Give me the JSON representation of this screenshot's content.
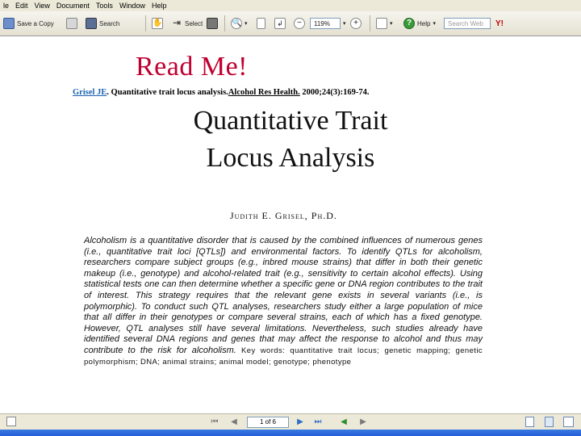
{
  "menu": {
    "items": [
      "le",
      "Edit",
      "View",
      "Document",
      "Tools",
      "Window",
      "Help"
    ]
  },
  "toolbar": {
    "save_copy": "Save a Copy",
    "search": "Search",
    "select": "Select",
    "zoom_value": "119%",
    "help": "Help",
    "search_web_placeholder": "Search Web",
    "yahoo": "Y!"
  },
  "document": {
    "heading": "Read Me!",
    "citation": {
      "author_link": "Grisel JE",
      "after_author": ". Quantitative trait locus analysis.",
      "journal": "Alcohol Res Health.",
      "rest": " 2000;24(3):169-74."
    },
    "title_line1": "Quantitative Trait",
    "title_line2": "Locus Analysis",
    "author": "Judith E. Grisel, Ph.D.",
    "abstract": "Alcoholism is a quantitative disorder that is caused by the combined influences of numerous genes (i.e., quantitative trait loci [QTLs]) and environmental factors. To identify QTLs for alcoholism, researchers compare subject groups (e.g., inbred mouse strains) that differ in both their genetic makeup (i.e., genotype) and alcohol-related trait (e.g., sensitivity to certain alcohol effects). Using statistical tests one can then determine whether a specific gene or DNA region contributes to the trait of interest. This strategy requires that the relevant gene exists in several variants (i.e., is polymorphic). To conduct such QTL analyses, researchers study either a large population of mice that all differ in their genotypes or compare several strains, each of which has a fixed genotype. However, QTL analyses still have several limitations. Nevertheless, such studies already have identified several DNA regions and genes that may affect the response to alcohol and thus may contribute to the risk for alcoholism.",
    "keywords_label": "Key words:",
    "keywords": "quantitative trait locus; genetic mapping; genetic polymorphism; DNA; animal strains; animal model; genotype; phenotype"
  },
  "statusbar": {
    "page_indicator": "1 of 6"
  }
}
